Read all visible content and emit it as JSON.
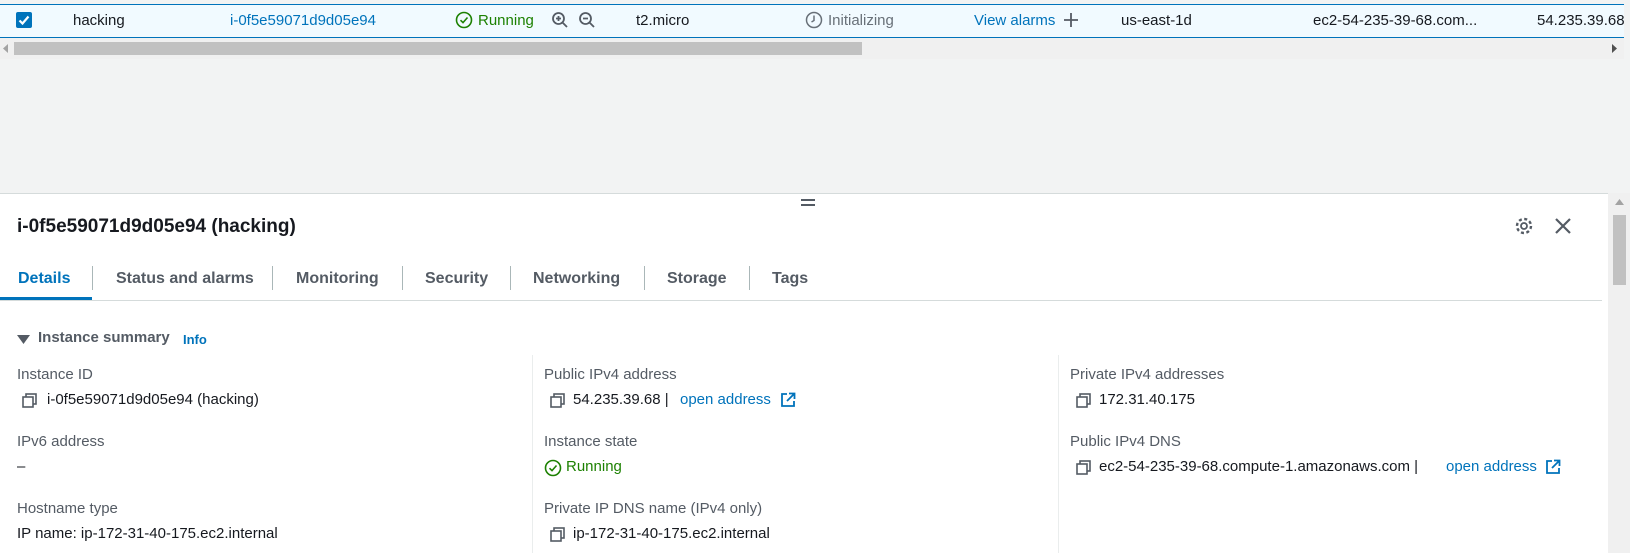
{
  "row": {
    "name": "hacking",
    "instance_id": "i-0f5e59071d9d05e94",
    "state": "Running",
    "type": "t2.micro",
    "status_check": "Initializing",
    "alarm_link": "View alarms",
    "az": "us-east-1d",
    "public_dns": "ec2-54-235-39-68.com...",
    "public_ip": "54.235.39.68"
  },
  "panel": {
    "title": "i-0f5e59071d9d05e94 (hacking)",
    "tabs": [
      "Details",
      "Status and alarms",
      "Monitoring",
      "Security",
      "Networking",
      "Storage",
      "Tags"
    ],
    "section_title": "Instance summary",
    "info_link": "Info",
    "fields": {
      "instance_id_label": "Instance ID",
      "instance_id_value": "i-0f5e59071d9d05e94 (hacking)",
      "ipv6_label": "IPv6 address",
      "ipv6_value": "–",
      "hostname_label": "Hostname type",
      "hostname_value": "IP name: ip-172-31-40-175.ec2.internal",
      "public_ip_label": "Public IPv4 address",
      "public_ip_value": "54.235.39.68 |",
      "open_address": "open address",
      "state_label": "Instance state",
      "state_value": "Running",
      "private_dns_label": "Private IP DNS name (IPv4 only)",
      "private_dns_value": "ip-172-31-40-175.ec2.internal",
      "private_ip_label": "Private IPv4 addresses",
      "private_ip_value": "172.31.40.175",
      "public_dns_label": "Public IPv4 DNS",
      "public_dns_value": "ec2-54-235-39-68.compute-1.amazonaws.com |"
    }
  }
}
